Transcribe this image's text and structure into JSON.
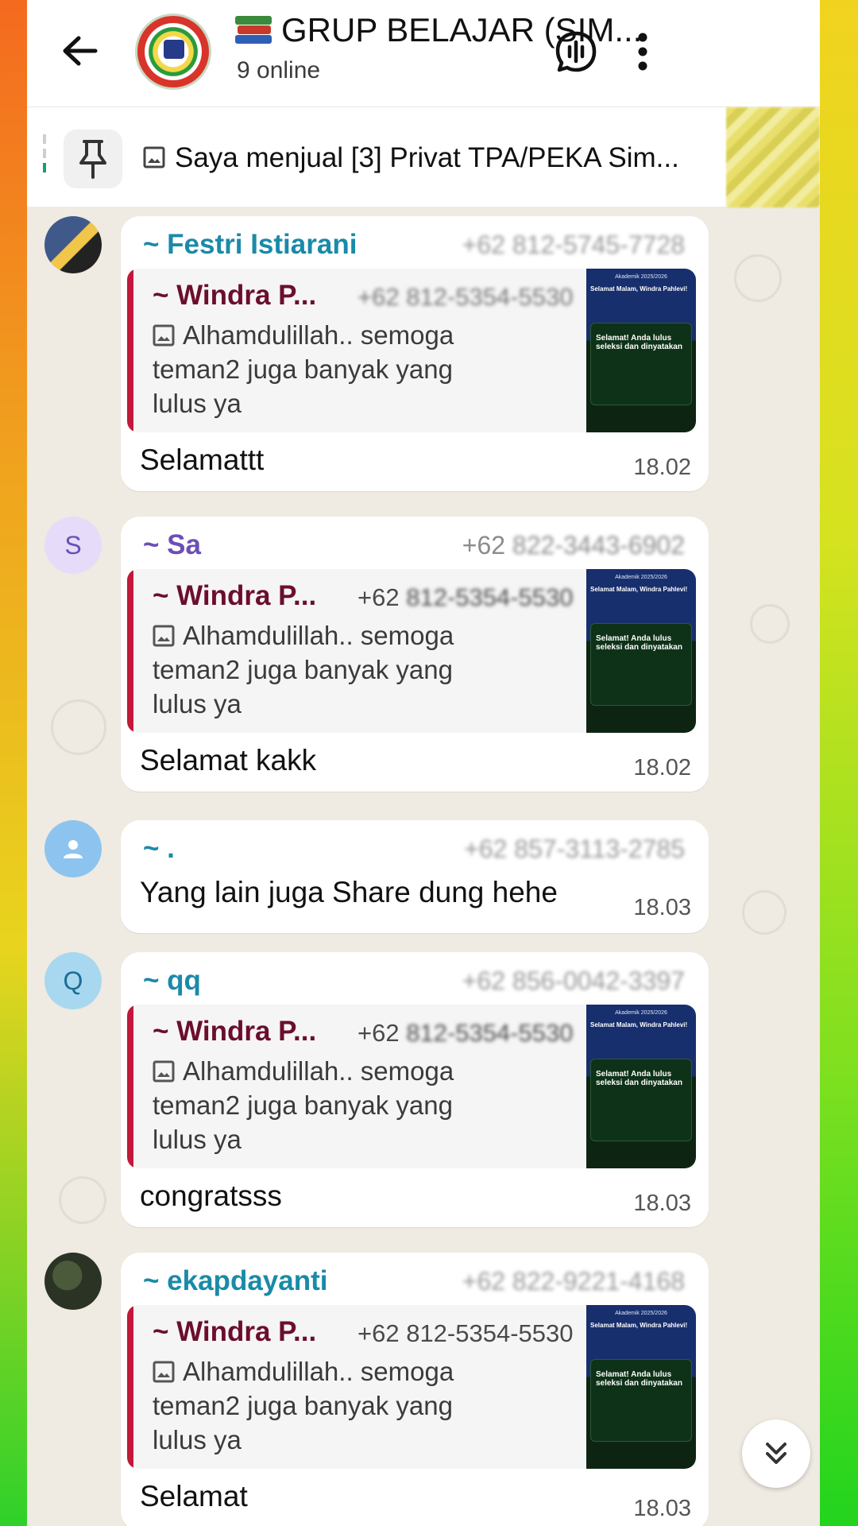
{
  "header": {
    "title": "GRUP BELAJAR (SIM...",
    "subtitle": "9 online"
  },
  "pinned": {
    "text": "Saya menjual [3] Privat TPA/PEKA Sim..."
  },
  "messages": [
    {
      "sender": "~ Festri Istiarani",
      "sender_color": "#1a8aa8",
      "phone": "+62 812-5745-7728",
      "phone_blurred": true,
      "quote_author": "~ Windra P...",
      "quote_phone": "+62 812-5354-5530",
      "quote_phone_blurred": true,
      "quote_text": "Alhamdulillah.. semoga teman2 juga banyak yang lulus ya",
      "text": "Selamattt",
      "time": "18.02"
    },
    {
      "sender": "~ Sa",
      "sender_color": "#6a4fb8",
      "avatar_letter": "S",
      "phone": "+62",
      "phone_blur_part": "822-3443-6902",
      "quote_author": "~ Windra P...",
      "quote_phone": "+62",
      "quote_phone_blur_part": "812-5354-5530",
      "quote_text": "Alhamdulillah.. semoga teman2 juga banyak yang lulus ya",
      "text": "Selamat kakk",
      "time": "18.02"
    },
    {
      "sender": "~ .",
      "sender_color": "#1a8aa8",
      "phone": "+62 857-3113-2785",
      "phone_blurred": true,
      "text": "Yang lain juga Share dung hehe",
      "time": "18.03"
    },
    {
      "sender": "~ qq",
      "sender_color": "#1a8aa8",
      "avatar_letter": "Q",
      "phone": "+62 856-0042-3397",
      "phone_blurred": true,
      "quote_author": "~ Windra P...",
      "quote_phone": "+62",
      "quote_phone_blur_part": "812-5354-5530",
      "quote_text": "Alhamdulillah.. semoga teman2 juga banyak yang lulus ya",
      "text": "congratsss",
      "time": "18.03"
    },
    {
      "sender": "~ ekapdayanti",
      "sender_color": "#1a8aa8",
      "phone": "+62 822-9221-4168",
      "phone_blurred": true,
      "quote_author": "~ Windra P...",
      "quote_phone": "+62 812-5354-5530",
      "quote_text": "Alhamdulillah.. semoga teman2 juga banyak yang lulus ya",
      "text": "Selamat",
      "time": "18.03"
    }
  ],
  "thumb": {
    "line1": "Akademik 2025/2026",
    "line2": "Selamat Malam, Windra Pahlevi!",
    "line3": "Selamat! Anda lulus seleksi dan dinyatakan"
  },
  "colors": {
    "accent": "#1aa06b",
    "quote_bar": "#c2183b",
    "quote_author": "#6b0e2c",
    "chat_bg": "#efeae2"
  },
  "icons": {
    "back": "arrow-left-icon",
    "voice_chat": "voice-chat-icon",
    "menu": "more-vert-icon",
    "pin": "pin-icon",
    "image": "image-icon",
    "scroll_down": "double-chevron-down-icon"
  }
}
